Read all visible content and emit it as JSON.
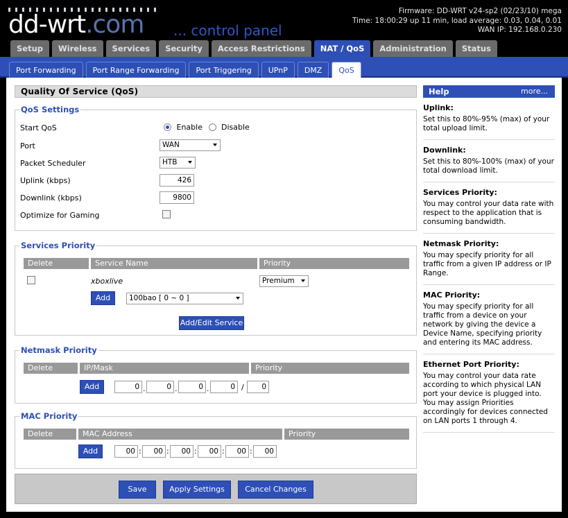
{
  "brand": {
    "logo_main": "dd-wrt",
    "logo_suffix": ".com",
    "subtitle": "... control panel"
  },
  "router_info": {
    "firmware": "Firmware: DD-WRT v24-sp2 (02/23/10) mega",
    "time": "Time: 18:00:29 up 11 min, load average: 0.03, 0.04, 0.01",
    "wan_ip": "WAN IP: 192.168.0.230"
  },
  "main_tabs": [
    {
      "label": "Setup"
    },
    {
      "label": "Wireless"
    },
    {
      "label": "Services"
    },
    {
      "label": "Security"
    },
    {
      "label": "Access Restrictions"
    },
    {
      "label": "NAT / QoS",
      "active": true
    },
    {
      "label": "Administration"
    },
    {
      "label": "Status"
    }
  ],
  "sub_tabs": [
    {
      "label": "Port Forwarding"
    },
    {
      "label": "Port Range Forwarding"
    },
    {
      "label": "Port Triggering"
    },
    {
      "label": "UPnP"
    },
    {
      "label": "DMZ"
    },
    {
      "label": "QoS",
      "active": true
    }
  ],
  "page_title": "Quality Of Service (QoS)",
  "qos_settings": {
    "legend": "QoS Settings",
    "start_qos_label": "Start QoS",
    "enable_label": "Enable",
    "disable_label": "Disable",
    "start_qos_value": "Enable",
    "port_label": "Port",
    "port_value": "WAN",
    "scheduler_label": "Packet Scheduler",
    "scheduler_value": "HTB",
    "uplink_label": "Uplink (kbps)",
    "uplink_value": "426",
    "downlink_label": "Downlink (kbps)",
    "downlink_value": "9800",
    "gaming_label": "Optimize for Gaming",
    "gaming_checked": false
  },
  "services_priority": {
    "legend": "Services Priority",
    "headers": {
      "delete": "Delete",
      "name": "Service Name",
      "priority": "Priority"
    },
    "rows": [
      {
        "name": "xboxlive",
        "priority": "Premium"
      }
    ],
    "add_label": "Add",
    "service_select": "100bao [ 0 ~ 0 ]",
    "add_edit_label": "Add/Edit Service"
  },
  "netmask_priority": {
    "legend": "Netmask Priority",
    "headers": {
      "delete": "Delete",
      "ipmask": "IP/Mask",
      "priority": "Priority"
    },
    "add_label": "Add",
    "ip": [
      "0",
      "0",
      "0",
      "0"
    ],
    "mask": "0",
    "dot": ".",
    "slash": "/"
  },
  "mac_priority": {
    "legend": "MAC Priority",
    "headers": {
      "delete": "Delete",
      "mac": "MAC Address",
      "priority": "Priority"
    },
    "add_label": "Add",
    "mac": [
      "00",
      "00",
      "00",
      "00",
      "00",
      "00"
    ],
    "colon": ":"
  },
  "footer": {
    "save": "Save",
    "apply": "Apply Settings",
    "cancel": "Cancel Changes"
  },
  "help": {
    "title": "Help",
    "more": "more...",
    "sections": [
      {
        "title": "Uplink:",
        "body": "Set this to 80%-95% (max) of your total upload limit."
      },
      {
        "title": "Downlink:",
        "body": "Set this to 80%-100% (max) of your total download limit."
      },
      {
        "title": "Services Priority:",
        "body": "You may control your data rate with respect to the application that is consuming bandwidth."
      },
      {
        "title": "Netmask Priority:",
        "body": "You may specify priority for all traffic from a given IP address or IP Range."
      },
      {
        "title": "MAC Priority:",
        "body": "You may specify priority for all traffic from a device on your network by giving the device a Device Name, specifying priority and entering its MAC address."
      },
      {
        "title": "Ethernet Port Priority:",
        "body": "You may control your data rate according to which physical LAN port your device is plugged into. You may assign Priorities accordingly for devices connected on LAN ports 1 through 4."
      }
    ]
  }
}
